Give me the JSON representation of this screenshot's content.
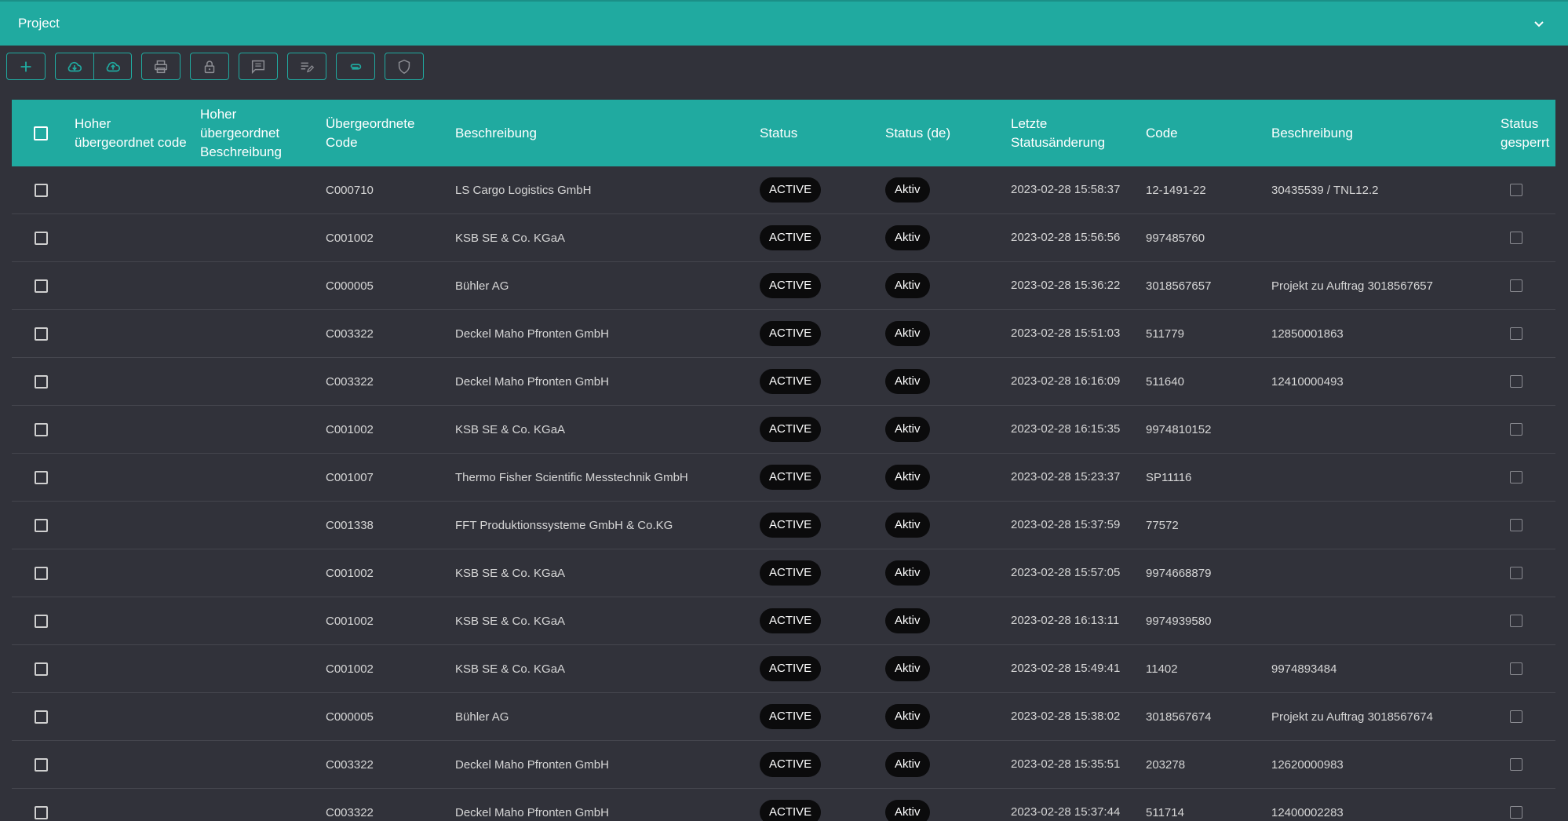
{
  "header": {
    "title": "Project"
  },
  "colors": {
    "accent": "#20aaa0",
    "background": "#31323a",
    "pill": "#0b0b0c"
  },
  "toolbar": {
    "icons": [
      "plus-icon",
      "cloud-download-icon",
      "cloud-upload-icon",
      "print-icon",
      "lock-icon",
      "comment-icon",
      "edit-notes-icon",
      "link-icon",
      "shield-icon"
    ]
  },
  "table": {
    "headers": {
      "parent_code": "Hoher übergeordnet code",
      "parent_desc": "Hoher übergeordnet Beschreibung",
      "code_parent": "Übergeordnete Code",
      "desc_parent": "Beschreibung",
      "status": "Status",
      "status_de": "Status (de)",
      "last_change": "Letzte Statusänderung",
      "code": "Code",
      "desc": "Beschreibung",
      "locked": "Status gesperrt"
    },
    "rows": [
      {
        "code_parent": "C000710",
        "desc_parent": "LS Cargo Logistics GmbH",
        "status": "ACTIVE",
        "status_de": "Aktiv",
        "last_change": "2023-02-28 15:58:37",
        "code": "12-1491-22",
        "desc": "30435539 / TNL12.2"
      },
      {
        "code_parent": "C001002",
        "desc_parent": "KSB SE & Co. KGaA",
        "status": "ACTIVE",
        "status_de": "Aktiv",
        "last_change": "2023-02-28 15:56:56",
        "code": "997485760",
        "desc": ""
      },
      {
        "code_parent": "C000005",
        "desc_parent": "Bühler AG",
        "status": "ACTIVE",
        "status_de": "Aktiv",
        "last_change": "2023-02-28 15:36:22",
        "code": "3018567657",
        "desc": "Projekt zu Auftrag 3018567657"
      },
      {
        "code_parent": "C003322",
        "desc_parent": "Deckel Maho Pfronten GmbH",
        "status": "ACTIVE",
        "status_de": "Aktiv",
        "last_change": "2023-02-28 15:51:03",
        "code": "511779",
        "desc": "12850001863"
      },
      {
        "code_parent": "C003322",
        "desc_parent": "Deckel Maho Pfronten GmbH",
        "status": "ACTIVE",
        "status_de": "Aktiv",
        "last_change": "2023-02-28 16:16:09",
        "code": "511640",
        "desc": "12410000493"
      },
      {
        "code_parent": "C001002",
        "desc_parent": "KSB SE & Co. KGaA",
        "status": "ACTIVE",
        "status_de": "Aktiv",
        "last_change": "2023-02-28 16:15:35",
        "code": "9974810152",
        "desc": ""
      },
      {
        "code_parent": "C001007",
        "desc_parent": "Thermo Fisher Scientific Messtechnik GmbH",
        "status": "ACTIVE",
        "status_de": "Aktiv",
        "last_change": "2023-02-28 15:23:37",
        "code": "SP11116",
        "desc": ""
      },
      {
        "code_parent": "C001338",
        "desc_parent": "FFT Produktionssysteme GmbH & Co.KG",
        "status": "ACTIVE",
        "status_de": "Aktiv",
        "last_change": "2023-02-28 15:37:59",
        "code": "77572",
        "desc": ""
      },
      {
        "code_parent": "C001002",
        "desc_parent": "KSB SE & Co. KGaA",
        "status": "ACTIVE",
        "status_de": "Aktiv",
        "last_change": "2023-02-28 15:57:05",
        "code": "9974668879",
        "desc": ""
      },
      {
        "code_parent": "C001002",
        "desc_parent": "KSB SE & Co. KGaA",
        "status": "ACTIVE",
        "status_de": "Aktiv",
        "last_change": "2023-02-28 16:13:11",
        "code": "9974939580",
        "desc": ""
      },
      {
        "code_parent": "C001002",
        "desc_parent": "KSB SE & Co. KGaA",
        "status": "ACTIVE",
        "status_de": "Aktiv",
        "last_change": "2023-02-28 15:49:41",
        "code": "11402",
        "desc": "9974893484"
      },
      {
        "code_parent": "C000005",
        "desc_parent": "Bühler AG",
        "status": "ACTIVE",
        "status_de": "Aktiv",
        "last_change": "2023-02-28 15:38:02",
        "code": "3018567674",
        "desc": "Projekt zu Auftrag 3018567674"
      },
      {
        "code_parent": "C003322",
        "desc_parent": "Deckel Maho Pfronten GmbH",
        "status": "ACTIVE",
        "status_de": "Aktiv",
        "last_change": "2023-02-28 15:35:51",
        "code": "203278",
        "desc": "12620000983"
      },
      {
        "code_parent": "C003322",
        "desc_parent": "Deckel Maho Pfronten GmbH",
        "status": "ACTIVE",
        "status_de": "Aktiv",
        "last_change": "2023-02-28 15:37:44",
        "code": "511714",
        "desc": "12400002283"
      }
    ]
  }
}
